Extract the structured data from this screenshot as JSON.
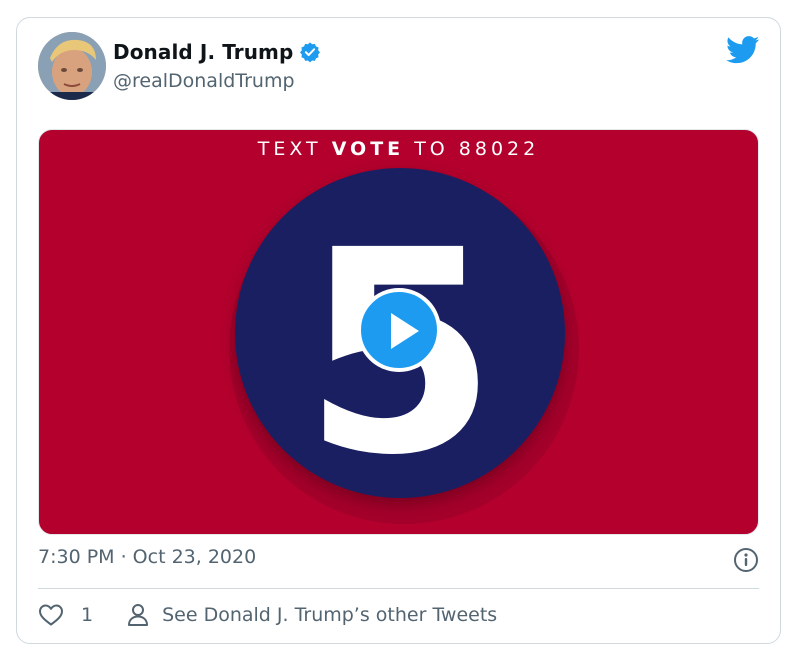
{
  "tweet": {
    "author_name": "Donald J. Trump",
    "handle": "@realDonaldTrump",
    "timestamp": "7:30 PM · Oct 23, 2020",
    "likes": "1",
    "other_tweets_label": "See Donald J. Trump’s other Tweets"
  },
  "media": {
    "text_prefix": "TEXT ",
    "text_bold": "VOTE",
    "text_suffix": " TO 88022",
    "big_number": "5"
  },
  "icons": {
    "verified": "verified-badge-icon",
    "brand": "twitter-bird-icon",
    "play": "play-icon",
    "info": "info-icon",
    "like": "heart-icon",
    "profile": "person-icon"
  },
  "colors": {
    "twitter_blue": "#1d9bf0",
    "media_red": "#b3002d",
    "circle_navy": "#1a1f62",
    "text_primary": "#0f1419",
    "text_secondary": "#536471"
  }
}
